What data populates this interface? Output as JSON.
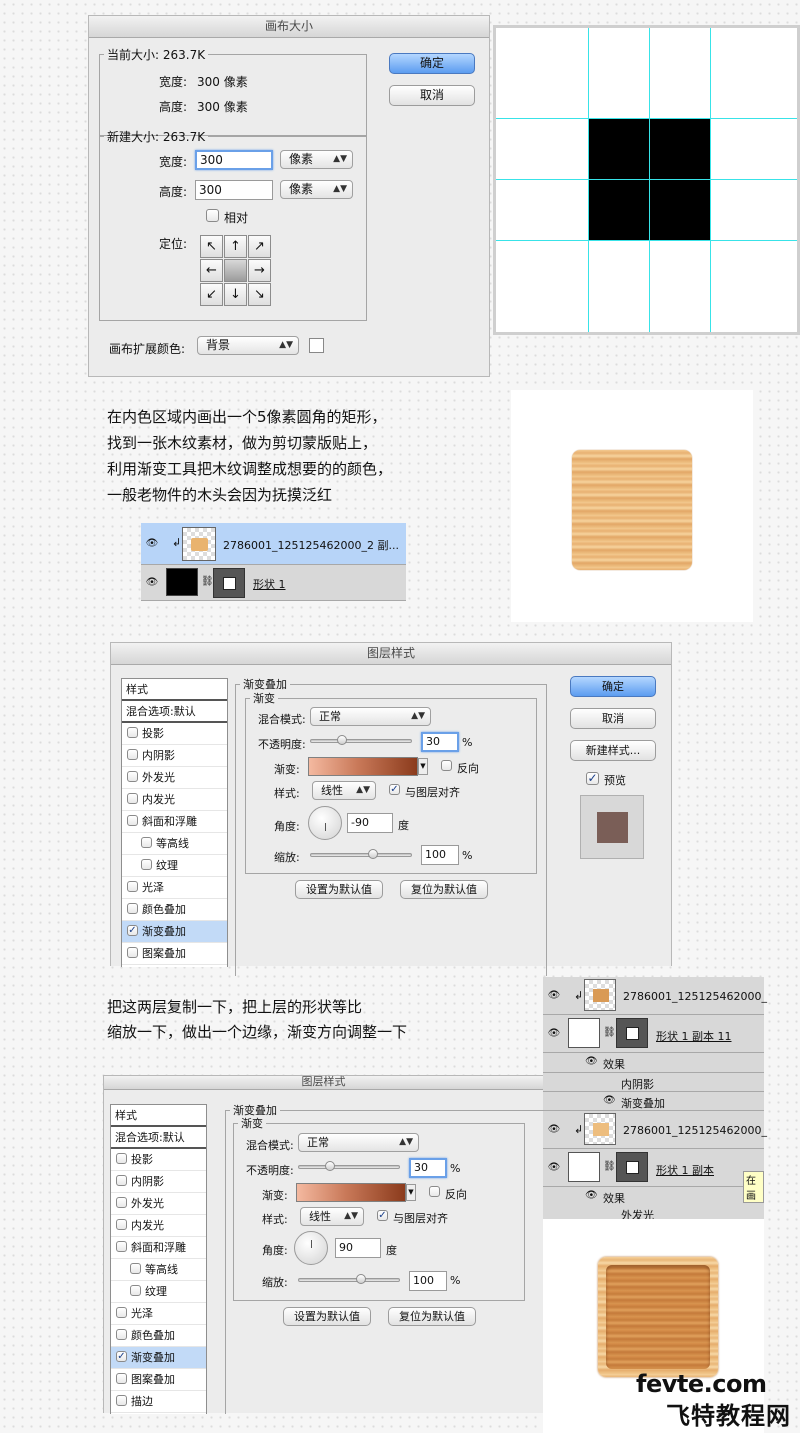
{
  "canvas_dialog": {
    "title": "画布大小",
    "current_size": "当前大小: 263.7K",
    "current_width_label": "宽度:",
    "current_width": "300 像素",
    "current_height_label": "高度:",
    "current_height": "300 像素",
    "new_size": "新建大小: 263.7K",
    "width_label": "宽度:",
    "width_value": "300",
    "height_label": "高度:",
    "height_value": "300",
    "unit": "像素",
    "relative_label": "相对",
    "anchor_label": "定位:",
    "ext_color_label": "画布扩展颜色:",
    "ext_color_value": "背景",
    "ok": "确定",
    "cancel": "取消"
  },
  "step1_text": [
    "在内色区域内画出一个5像素圆角的矩形，",
    "找到一张木纹素材，做为剪切蒙版贴上，",
    "利用渐变工具把木纹调整成想要的的颜色，",
    "一般老物件的木头会因为抚摸泛红"
  ],
  "layers1": {
    "row1": "2786001_125125462000_2 副...",
    "row2": "形状 1"
  },
  "layer_style1": {
    "title": "图层样式",
    "list_header": "样式",
    "blend_default": "混合选项:默认",
    "items": [
      "投影",
      "内阴影",
      "外发光",
      "内发光",
      "斜面和浮雕",
      "等高线",
      "纹理",
      "光泽",
      "颜色叠加",
      "渐变叠加",
      "图案叠加"
    ],
    "section": "渐变叠加",
    "sub_section": "渐变",
    "blend_mode_label": "混合模式:",
    "blend_mode": "正常",
    "opacity_label": "不透明度:",
    "opacity": "30",
    "pct": "%",
    "gradient_label": "渐变:",
    "reverse": "反向",
    "style_label": "样式:",
    "style": "线性",
    "align": "与图层对齐",
    "angle_label": "角度:",
    "angle": "-90",
    "deg": "度",
    "scale_label": "缩放:",
    "scale": "100",
    "set_default": "设置为默认值",
    "reset_default": "复位为默认值",
    "ok": "确定",
    "cancel": "取消",
    "new_style": "新建样式...",
    "preview": "预览"
  },
  "step2_text": [
    "把这两层复制一下，把上层的形状等比",
    "缩放一下，做出一个边缘，渐变方向调整一下"
  ],
  "layer_style2": {
    "title": "图层样式",
    "list_header": "样式",
    "blend_default": "混合选项:默认",
    "items": [
      "投影",
      "内阴影",
      "外发光",
      "内发光",
      "斜面和浮雕",
      "等高线",
      "纹理",
      "光泽",
      "颜色叠加",
      "渐变叠加",
      "图案叠加",
      "描边"
    ],
    "section": "渐变叠加",
    "sub_section": "渐变",
    "blend_mode_label": "混合模式:",
    "blend_mode": "正常",
    "opacity_label": "不透明度:",
    "opacity": "30",
    "pct": "%",
    "gradient_label": "渐变:",
    "reverse": "反向",
    "style_label": "样式:",
    "style": "线性",
    "align": "与图层对齐",
    "angle_label": "角度:",
    "angle": "90",
    "deg": "度",
    "scale_label": "缩放:",
    "scale": "100",
    "set_default": "设置为默认值",
    "reset_default": "复位为默认值"
  },
  "layers2": {
    "row1": "2786001_125125462000_",
    "row2": "形状 1 副本 11",
    "effects": "效果",
    "inner_shadow": "内阴影",
    "gradient_overlay": "渐变叠加",
    "row3": "2786001_125125462000_",
    "row4": "形状 1 副本",
    "effects2": "效果",
    "outer_glow": "外发光",
    "tooltip": "在画"
  },
  "watermark": {
    "site": "fevte.com",
    "name": "飞特教程网"
  },
  "colors": {
    "guide": "#38e3e8",
    "selection": "#b7d4f8",
    "wood_light": "#f3c98f",
    "wood_dark": "#d69550"
  }
}
